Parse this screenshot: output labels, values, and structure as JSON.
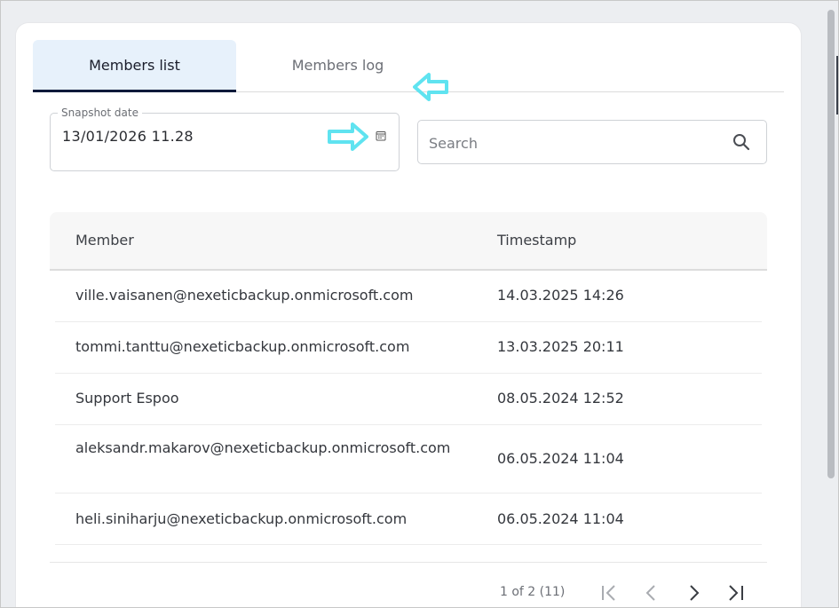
{
  "tabs": [
    {
      "label": "Members list",
      "active": true
    },
    {
      "label": "Members log",
      "active": false
    }
  ],
  "snapshot": {
    "label": "Snapshot date",
    "value": "13/01/2026 11.28"
  },
  "search": {
    "placeholder": "Search",
    "value": ""
  },
  "table": {
    "headers": {
      "member": "Member",
      "timestamp": "Timestamp"
    },
    "rows": [
      {
        "member": "ville.vaisanen@nexeticbackup.onmicrosoft.com",
        "timestamp": "14.03.2025 14:26"
      },
      {
        "member": "tommi.tanttu@nexeticbackup.onmicrosoft.com",
        "timestamp": "13.03.2025 20:11"
      },
      {
        "member": "Support Espoo",
        "timestamp": "08.05.2024 12:52"
      },
      {
        "member": "aleksandr.makarov@nexeticbackup.onmicrosoft.com",
        "timestamp": "06.05.2024 11:04"
      },
      {
        "member": "heli.siniharju@nexeticbackup.onmicrosoft.com",
        "timestamp": "06.05.2024 11:04"
      }
    ]
  },
  "pagination": {
    "info": "1 of 2 (11)"
  },
  "colors": {
    "active_tab_bg": "#e7f1fb",
    "active_tab_underline": "#0e1a3a",
    "annotation_arrow": "#5fe3f0"
  },
  "icons": {
    "calendar": "calendar-icon",
    "search": "search-icon",
    "first_page": "first-page-icon",
    "prev_page": "chevron-left-icon",
    "next_page": "chevron-right-icon",
    "last_page": "last-page-icon"
  }
}
